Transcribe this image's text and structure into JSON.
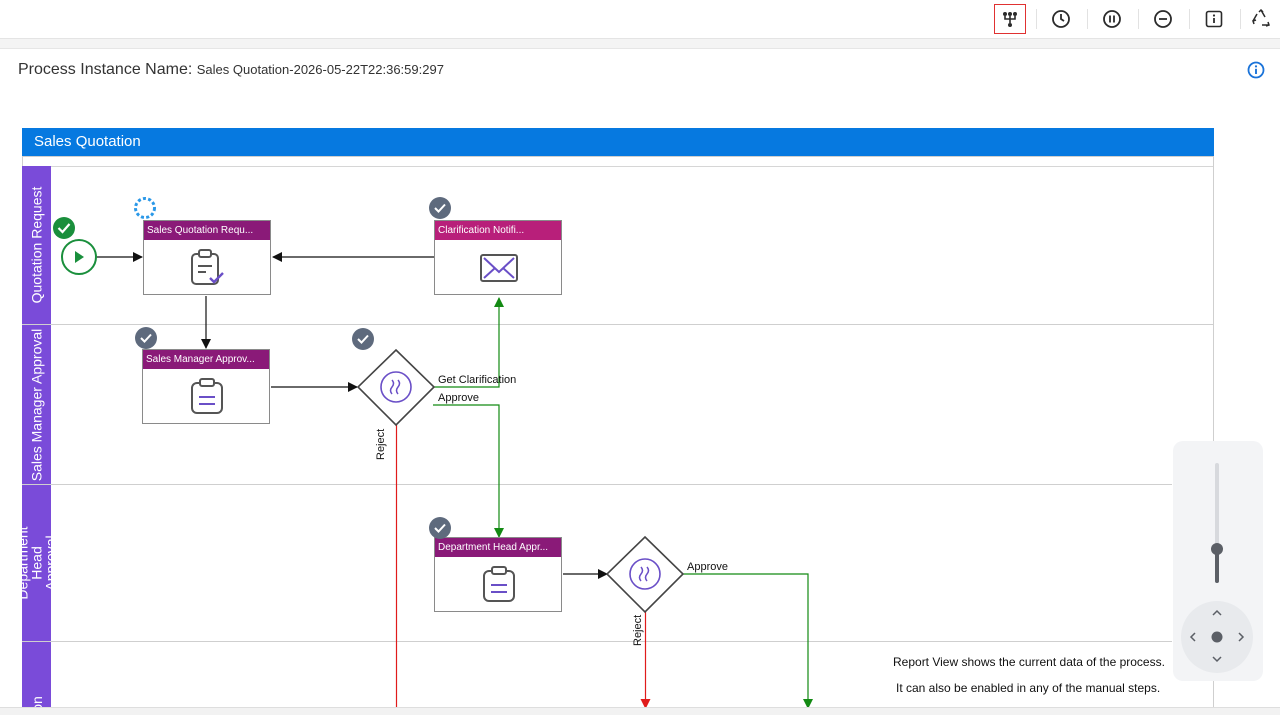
{
  "toolbar": {
    "buttons": [
      {
        "name": "flow-view",
        "icon": "branch-flow-icon",
        "active": true
      },
      {
        "name": "history",
        "icon": "clock-icon",
        "active": false
      },
      {
        "name": "suspend",
        "icon": "pause-circle-icon",
        "active": false
      },
      {
        "name": "cancel",
        "icon": "minus-circle-icon",
        "active": false
      },
      {
        "name": "info",
        "icon": "info-square-icon",
        "active": false
      },
      {
        "name": "recycle",
        "icon": "recycle-icon",
        "active": false
      }
    ]
  },
  "header": {
    "label": "Process Instance Name:",
    "value": "Sales Quotation-2026-05-22T22:36:59:297",
    "info_icon": "info-circle-icon"
  },
  "pool": {
    "title": "Sales Quotation",
    "lanes": [
      {
        "label": "Quotation Request"
      },
      {
        "label": "Sales Manager Approval"
      },
      {
        "label": "Department Head Approval"
      },
      {
        "label": "on"
      }
    ]
  },
  "tasks": {
    "sales_quotation_request": {
      "title": "Sales Quotation Requ...",
      "icon": "clipboard-check-icon",
      "status": "in-progress"
    },
    "clarification_notification": {
      "title": "Clarification Notifi...",
      "icon": "envelope-icon",
      "status": "completed"
    },
    "sales_manager_approval": {
      "title": "Sales Manager Approv...",
      "icon": "clipboard-list-icon",
      "status": "completed"
    },
    "department_head_approval": {
      "title": "Department Head Appr...",
      "icon": "clipboard-list-icon",
      "status": "completed"
    }
  },
  "gateways": {
    "sales_manager_gateway": {
      "status": "completed",
      "labels": {
        "get_clarification": "Get Clarification",
        "approve": "Approve",
        "reject": "Reject"
      }
    },
    "department_head_gateway": {
      "labels": {
        "approve": "Approve",
        "reject": "Reject"
      }
    }
  },
  "notes": {
    "line1": "Report View shows the current data of the process.",
    "line2": "It can also be enabled in any of the manual steps."
  },
  "zoom": {
    "level": 0.2
  },
  "colors": {
    "accent": "#0679e0",
    "lane": "#7a4bd9",
    "task_header": "#8a1a78",
    "notification_header": "#b81f7a",
    "flow_approve": "#138a13",
    "flow_reject": "#e01b1b",
    "done_badge": "#5e6a7d",
    "start_event": "#1a8f3c"
  }
}
